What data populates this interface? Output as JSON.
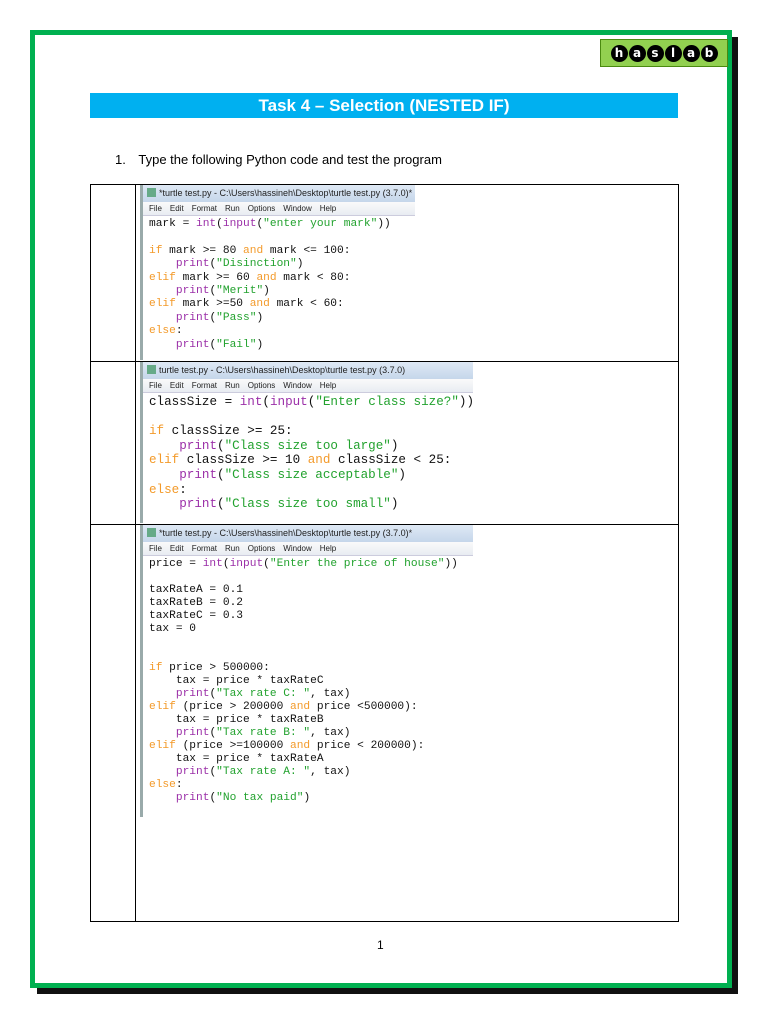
{
  "logo": {
    "letters": [
      "h",
      "a",
      "s",
      "l",
      "a",
      "b"
    ],
    "colors": {
      "background": "#92d050"
    }
  },
  "title": "Task 4 – Selection (NESTED IF)",
  "instruction": {
    "number": "1.",
    "text": "Type the following Python code and test the program"
  },
  "colors": {
    "frame": "#00b050",
    "title_bar": "#00b0f0",
    "keyword": "#f39a2a",
    "builtin": "#9b2fa8",
    "string": "#22a22e"
  },
  "menu": [
    "File",
    "Edit",
    "Format",
    "Run",
    "Options",
    "Window",
    "Help"
  ],
  "screenshots": [
    {
      "window_title": "*turtle test.py - C:\\Users\\hassineh\\Desktop\\turtle test.py (3.7.0)*",
      "lines": [
        [
          [
            "p",
            "mark = "
          ],
          [
            "bi",
            "int"
          ],
          [
            "p",
            "("
          ],
          [
            "bi",
            "input"
          ],
          [
            "p",
            "("
          ],
          [
            "str",
            "\"enter your mark\""
          ],
          [
            "p",
            "))"
          ]
        ],
        [],
        [
          [
            "kw",
            "if"
          ],
          [
            "p",
            " mark >= 80 "
          ],
          [
            "kw",
            "and"
          ],
          [
            "p",
            " mark <= 100:"
          ]
        ],
        [
          [
            "p",
            "    "
          ],
          [
            "bi",
            "print"
          ],
          [
            "p",
            "("
          ],
          [
            "str",
            "\"Disinction\""
          ],
          [
            "p",
            ")"
          ]
        ],
        [
          [
            "kw",
            "elif"
          ],
          [
            "p",
            " mark >= 60 "
          ],
          [
            "kw",
            "and"
          ],
          [
            "p",
            " mark < 80:"
          ]
        ],
        [
          [
            "p",
            "    "
          ],
          [
            "bi",
            "print"
          ],
          [
            "p",
            "("
          ],
          [
            "str",
            "\"Merit\""
          ],
          [
            "p",
            ")"
          ]
        ],
        [
          [
            "kw",
            "elif"
          ],
          [
            "p",
            " mark >=50 "
          ],
          [
            "kw",
            "and"
          ],
          [
            "p",
            " mark < 60:"
          ]
        ],
        [
          [
            "p",
            "    "
          ],
          [
            "bi",
            "print"
          ],
          [
            "p",
            "("
          ],
          [
            "str",
            "\"Pass\""
          ],
          [
            "p",
            ")"
          ]
        ],
        [
          [
            "kw",
            "else"
          ],
          [
            "p",
            ":"
          ]
        ],
        [
          [
            "p",
            "    "
          ],
          [
            "bi",
            "print"
          ],
          [
            "p",
            "("
          ],
          [
            "str",
            "\"Fail\""
          ],
          [
            "p",
            ")"
          ]
        ]
      ]
    },
    {
      "window_title": "turtle test.py - C:\\Users\\hassineh\\Desktop\\turtle test.py (3.7.0)",
      "lines": [
        [
          [
            "p",
            "classSize = "
          ],
          [
            "bi",
            "int"
          ],
          [
            "p",
            "("
          ],
          [
            "bi",
            "input"
          ],
          [
            "p",
            "("
          ],
          [
            "str",
            "\"Enter class size?\""
          ],
          [
            "p",
            "))"
          ]
        ],
        [],
        [
          [
            "kw",
            "if"
          ],
          [
            "p",
            " classSize >= 25:"
          ]
        ],
        [
          [
            "p",
            "    "
          ],
          [
            "bi",
            "print"
          ],
          [
            "p",
            "("
          ],
          [
            "str",
            "\"Class size too large\""
          ],
          [
            "p",
            ")"
          ]
        ],
        [
          [
            "kw",
            "elif"
          ],
          [
            "p",
            " classSize >= 10 "
          ],
          [
            "kw",
            "and"
          ],
          [
            "p",
            " classSize < 25:"
          ]
        ],
        [
          [
            "p",
            "    "
          ],
          [
            "bi",
            "print"
          ],
          [
            "p",
            "("
          ],
          [
            "str",
            "\"Class size acceptable\""
          ],
          [
            "p",
            ")"
          ]
        ],
        [
          [
            "kw",
            "else"
          ],
          [
            "p",
            ":"
          ]
        ],
        [
          [
            "p",
            "    "
          ],
          [
            "bi",
            "print"
          ],
          [
            "p",
            "("
          ],
          [
            "str",
            "\"Class size too small\""
          ],
          [
            "p",
            ")"
          ]
        ]
      ]
    },
    {
      "window_title": "*turtle test.py - C:\\Users\\hassineh\\Desktop\\turtle test.py (3.7.0)*",
      "lines": [
        [
          [
            "p",
            "price = "
          ],
          [
            "bi",
            "int"
          ],
          [
            "p",
            "("
          ],
          [
            "bi",
            "input"
          ],
          [
            "p",
            "("
          ],
          [
            "str",
            "\"Enter the price of house\""
          ],
          [
            "p",
            "))"
          ]
        ],
        [],
        [
          [
            "p",
            "taxRateA = 0.1"
          ]
        ],
        [
          [
            "p",
            "taxRateB = 0.2"
          ]
        ],
        [
          [
            "p",
            "taxRateC = 0.3"
          ]
        ],
        [
          [
            "p",
            "tax = 0"
          ]
        ],
        [],
        [],
        [
          [
            "kw",
            "if"
          ],
          [
            "p",
            " price > 500000:"
          ]
        ],
        [
          [
            "p",
            "    tax = price * taxRateC"
          ]
        ],
        [
          [
            "p",
            "    "
          ],
          [
            "bi",
            "print"
          ],
          [
            "p",
            "("
          ],
          [
            "str",
            "\"Tax rate C: \""
          ],
          [
            "p",
            ", tax)"
          ]
        ],
        [
          [
            "kw",
            "elif"
          ],
          [
            "p",
            " (price > 200000 "
          ],
          [
            "kw",
            "and"
          ],
          [
            "p",
            " price <500000):"
          ]
        ],
        [
          [
            "p",
            "    tax = price * taxRateB"
          ]
        ],
        [
          [
            "p",
            "    "
          ],
          [
            "bi",
            "print"
          ],
          [
            "p",
            "("
          ],
          [
            "str",
            "\"Tax rate B: \""
          ],
          [
            "p",
            ", tax)"
          ]
        ],
        [
          [
            "kw",
            "elif"
          ],
          [
            "p",
            " (price >=100000 "
          ],
          [
            "kw",
            "and"
          ],
          [
            "p",
            " price < 200000):"
          ]
        ],
        [
          [
            "p",
            "    tax = price * taxRateA"
          ]
        ],
        [
          [
            "p",
            "    "
          ],
          [
            "bi",
            "print"
          ],
          [
            "p",
            "("
          ],
          [
            "str",
            "\"Tax rate A: \""
          ],
          [
            "p",
            ", tax)"
          ]
        ],
        [
          [
            "kw",
            "else"
          ],
          [
            "p",
            ":"
          ]
        ],
        [
          [
            "p",
            "    "
          ],
          [
            "bi",
            "print"
          ],
          [
            "p",
            "("
          ],
          [
            "str",
            "\"No tax paid\""
          ],
          [
            "p",
            ")"
          ]
        ]
      ]
    }
  ],
  "page_number": "1"
}
